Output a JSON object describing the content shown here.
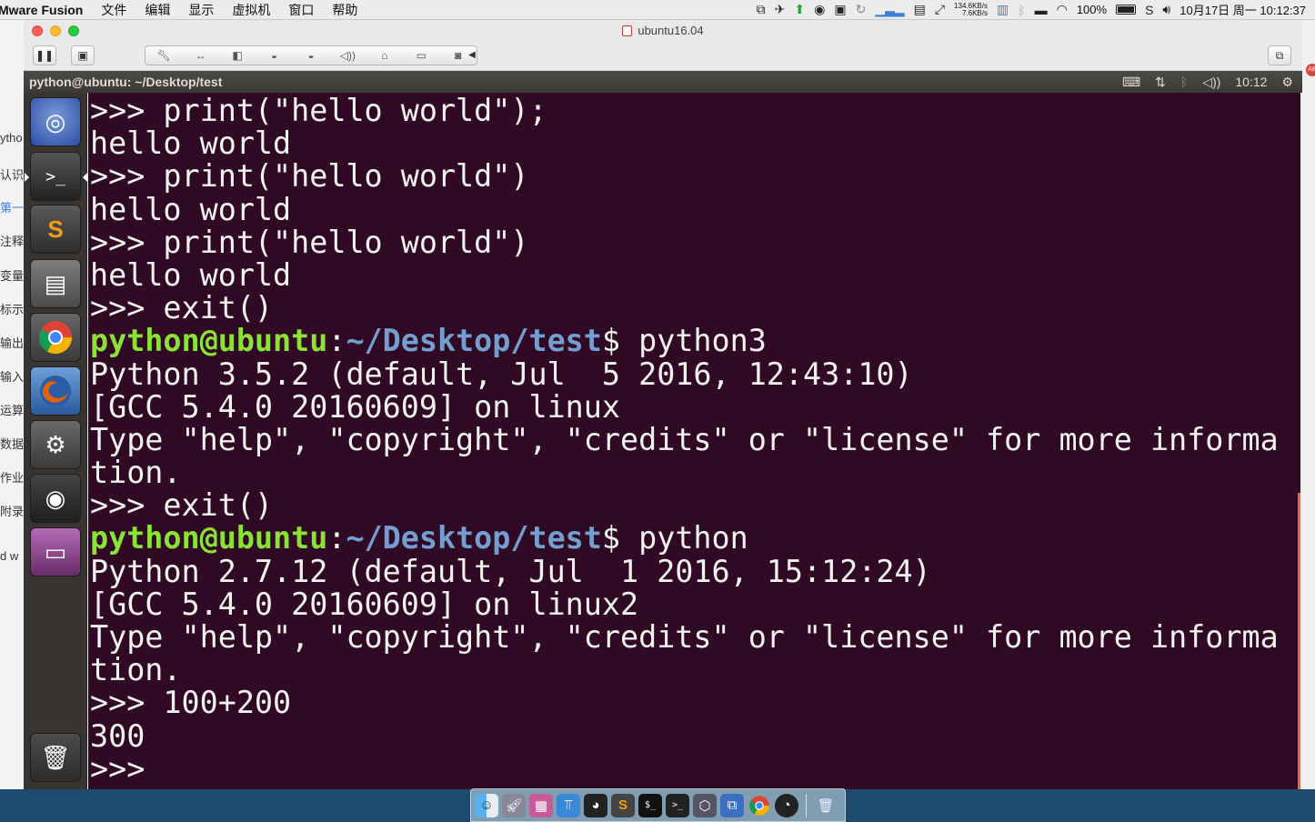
{
  "menubar": {
    "app_name": "Mware Fusion",
    "menus": [
      "文件",
      "编辑",
      "显示",
      "虚拟机",
      "窗口",
      "帮助"
    ],
    "net_up": "134.6KB/s",
    "net_down": "7.6KB/s",
    "battery": "100%",
    "datetime": "10月17日 周一  10:12:37"
  },
  "bg_strip": [
    "ytho",
    "认识",
    "第一",
    "注释",
    "变量",
    "标示",
    "输出",
    "输入",
    "运算",
    "数据",
    "作业",
    "附录",
    "d w"
  ],
  "window": {
    "title": "ubuntu16.04"
  },
  "ubuntu_panel": {
    "title": "python@ubuntu: ~/Desktop/test",
    "clock": "10:12"
  },
  "launcher": {
    "items": [
      "dash-home",
      "terminal",
      "sublime-text",
      "files",
      "chrome",
      "firefox",
      "system-settings",
      "disk",
      "workspace-switcher",
      "trash"
    ]
  },
  "terminal": {
    "prompt_user": "python@ubuntu",
    "prompt_path": "~/Desktop/test",
    "lines": [
      ">>> print(\"hello world\");",
      "hello world",
      ">>> print(\"hello world\")",
      "hello world",
      ">>> print(\"hello world\")",
      "hello world",
      ">>> exit()",
      "PROMPT|$ python3",
      "Python 3.5.2 (default, Jul  5 2016, 12:43:10)",
      "[GCC 5.4.0 20160609] on linux",
      "Type \"help\", \"copyright\", \"credits\" or \"license\" for more informa",
      "tion.",
      ">>> exit()",
      "PROMPT|$ python",
      "Python 2.7.12 (default, Jul  1 2016, 15:12:24)",
      "[GCC 5.4.0 20160609] on linux2",
      "Type \"help\", \"copyright\", \"credits\" or \"license\" for more informa",
      "tion.",
      ">>> 100+200",
      "300",
      ">>> "
    ]
  }
}
